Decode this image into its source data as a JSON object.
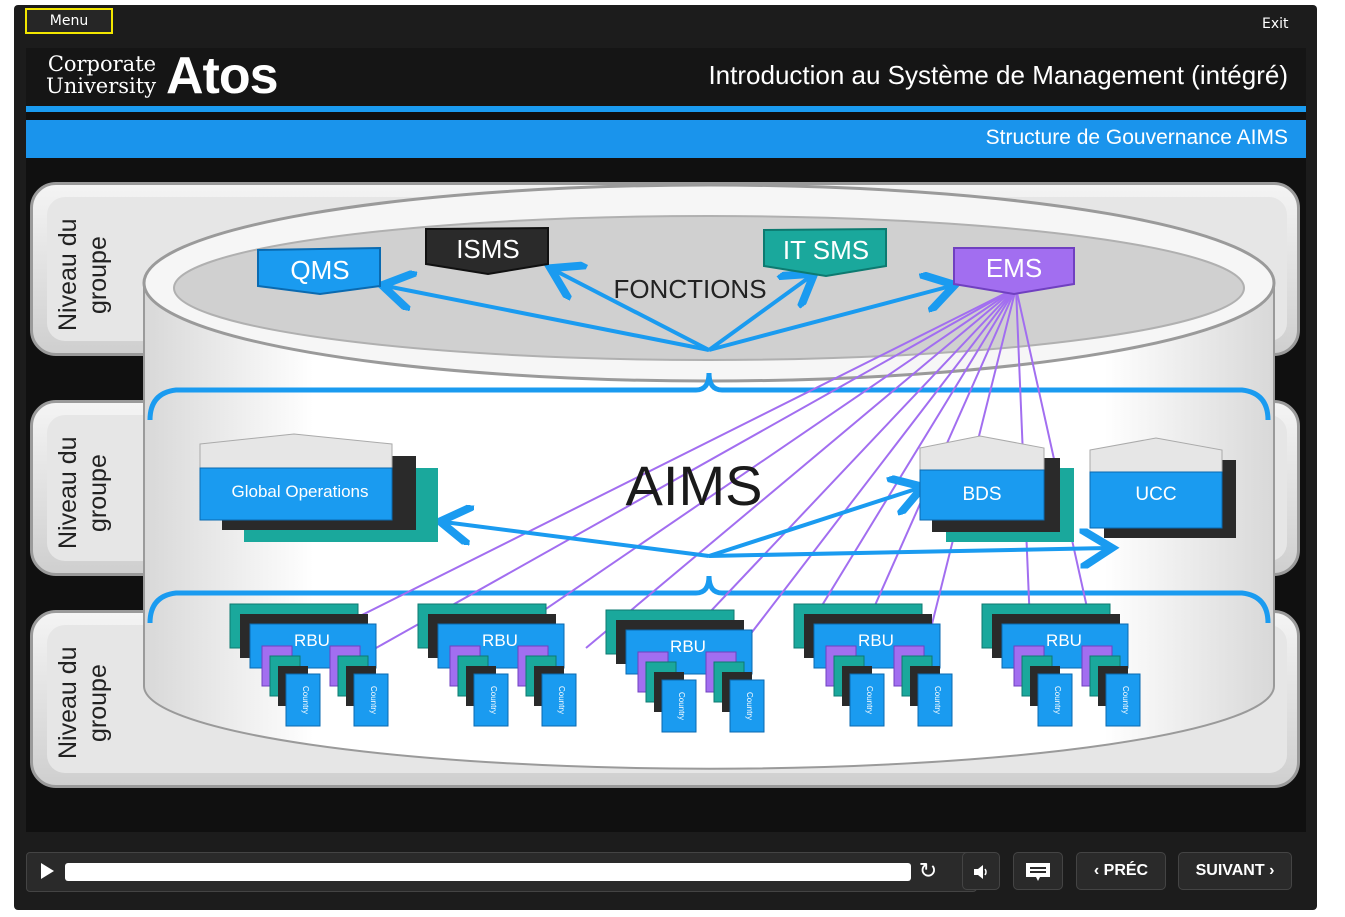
{
  "topbar": {
    "menu_label": "Menu",
    "exit_label": "Exit"
  },
  "header": {
    "logo_corporate": "Corporate",
    "logo_university": "University",
    "logo_brand": "Atos",
    "course_title": "Introduction au Système de Management (intégré)",
    "slide_subtitle": "Structure de Gouvernance AIMS"
  },
  "levels": [
    {
      "label_line1": "Niveau du",
      "label_line2": "groupe"
    },
    {
      "label_line1": "Niveau du",
      "label_line2": "groupe"
    },
    {
      "label_line1": "Niveau du",
      "label_line2": "groupe"
    }
  ],
  "diagram": {
    "functions_label": "FONCTIONS",
    "center_label": "AIMS",
    "functions": [
      {
        "label": "QMS",
        "color": "#1a9bf0"
      },
      {
        "label": "ISMS",
        "color": "#2a2a2a"
      },
      {
        "label": "IT SMS",
        "color": "#1aa89c"
      },
      {
        "label": "EMS",
        "color": "#a26ef0"
      }
    ],
    "business_units": [
      {
        "label": "Global Operations",
        "color": "#1a9bf0"
      },
      {
        "label": "BDS",
        "color": "#1a9bf0"
      },
      {
        "label": "UCC",
        "color": "#1a9bf0"
      }
    ],
    "rbu_label": "RBU",
    "country_label": "Country",
    "rbu_count": 5,
    "connector_color": "#1a9bf0",
    "ems_link_color": "#a26ef0"
  },
  "controls": {
    "prev_label": "‹ PRÉC",
    "next_label": "SUIVANT ›",
    "icons": [
      "play-icon",
      "replay-icon",
      "volume-icon",
      "captions-icon"
    ]
  }
}
